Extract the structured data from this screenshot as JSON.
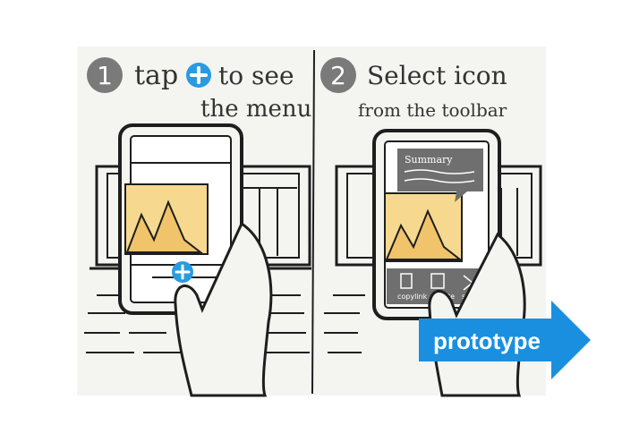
{
  "colors": {
    "paper": "#f4f4f1",
    "ink": "#1e1e1e",
    "badge": "#7a7a7a",
    "plus_blue": "#2a9be0",
    "photo_yellow": "#f6d98e",
    "phone_screen": "#ffffff",
    "toolbar_gray": "#6f6f6f",
    "arrow_blue": "#1a8fe0"
  },
  "panels": [
    {
      "step_number": "1",
      "line1_before": "tap",
      "line1_after": "to see",
      "line2": "the menu",
      "icon": "plus-icon"
    },
    {
      "step_number": "2",
      "line1": "Select icon",
      "line2": "from the toolbar",
      "bubble_title": "Summary",
      "toolbar_items": [
        "copylink",
        "note",
        "share"
      ]
    }
  ],
  "cta": {
    "label": "prototype",
    "icon": "right-arrow-icon"
  }
}
